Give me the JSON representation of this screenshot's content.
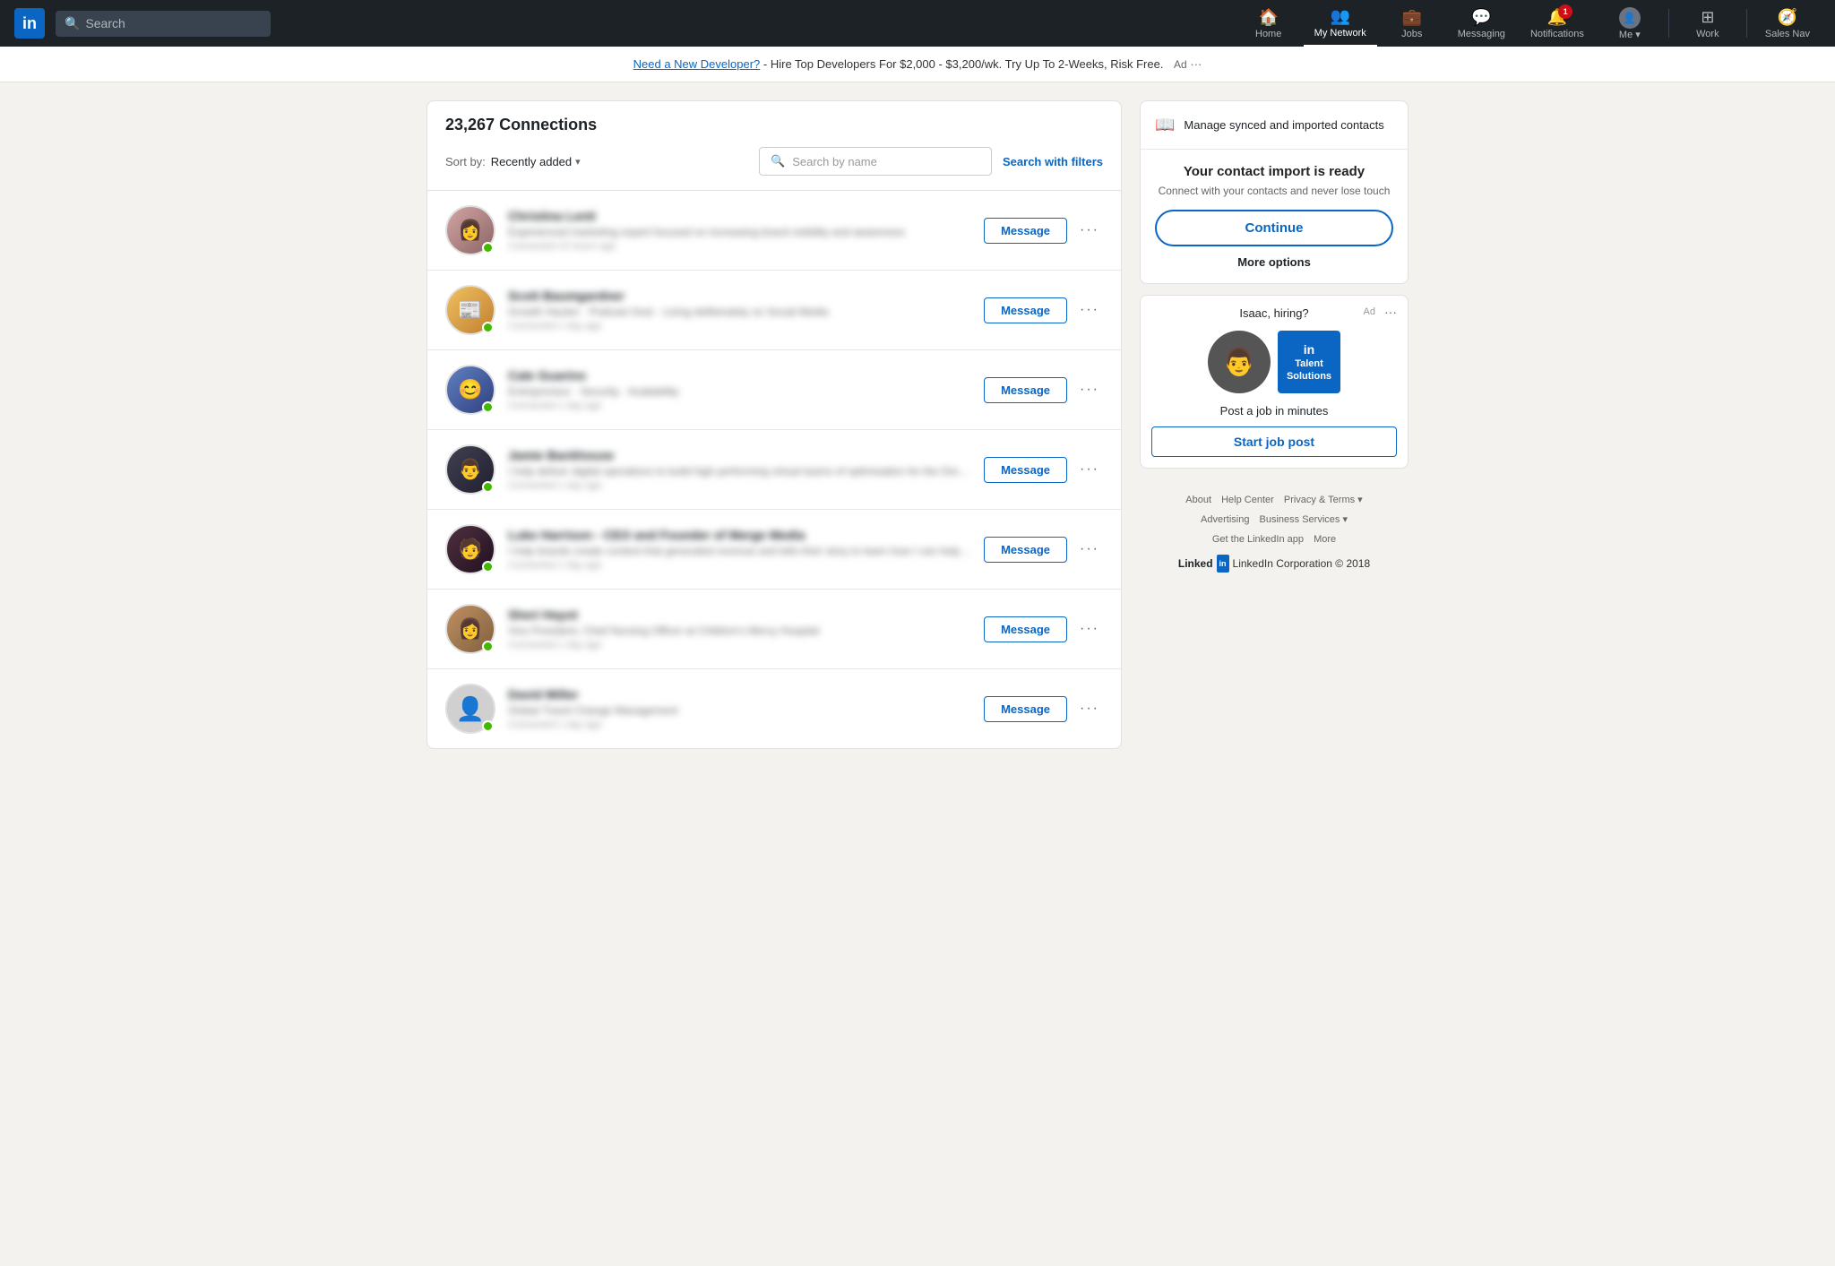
{
  "brand": {
    "logo": "in",
    "name": "LinkedIn"
  },
  "navbar": {
    "search_placeholder": "Search",
    "items": [
      {
        "id": "home",
        "label": "Home",
        "icon": "🏠",
        "badge": null,
        "active": false
      },
      {
        "id": "my-network",
        "label": "My Network",
        "icon": "👥",
        "badge": null,
        "active": true
      },
      {
        "id": "jobs",
        "label": "Jobs",
        "icon": "💼",
        "badge": null,
        "active": false
      },
      {
        "id": "messaging",
        "label": "Messaging",
        "icon": "💬",
        "badge": null,
        "active": false
      },
      {
        "id": "notifications",
        "label": "Notifications",
        "icon": "🔔",
        "badge": "1",
        "active": false
      },
      {
        "id": "me",
        "label": "Me",
        "icon": "👤",
        "badge": null,
        "active": false,
        "has_dropdown": true
      },
      {
        "id": "work",
        "label": "Work",
        "icon": "⊞",
        "badge": null,
        "active": false,
        "has_dropdown": true
      },
      {
        "id": "sales-nav",
        "label": "Sales Nav",
        "icon": "🧭",
        "badge": null,
        "active": false
      }
    ]
  },
  "ad_banner": {
    "link_text": "Need a New Developer?",
    "rest_text": " - Hire Top Developers For $2,000 - $3,200/wk. Try Up To 2-Weeks, Risk Free.",
    "label": "Ad",
    "more": "···"
  },
  "connections": {
    "count": "23,267",
    "title": "Connections",
    "sort_label": "Sort by:",
    "sort_value": "Recently added",
    "search_placeholder": "Search by name",
    "search_with_filters": "Search with filters",
    "items": [
      {
        "id": 1,
        "name": "Christina Lenti",
        "title": "Experienced marketing expert focused on increasing brand visibility and awareness",
        "time": "Connected 10 hours ago",
        "online": true,
        "avatar_class": "av1"
      },
      {
        "id": 2,
        "name": "Scott Baumgardner",
        "title": "Growth Hacker · Podcast Host · Living deliberately on Social Media",
        "time": "Connected 1 day ago",
        "online": true,
        "avatar_class": "av2"
      },
      {
        "id": 3,
        "name": "Cale Guarino",
        "title": "Entrepreneur · Security · Availability",
        "time": "Connected 1 day ago",
        "online": true,
        "avatar_class": "av3"
      },
      {
        "id": 4,
        "name": "Jamie Backhouse",
        "title": "I help deliver digital operations to build high performing virtual teams of optimisation for the Dream Team Interview",
        "time": "Connected 1 day ago",
        "online": true,
        "avatar_class": "av4"
      },
      {
        "id": 5,
        "name": "Luke Harrison - CEO and Founder of Merge Media",
        "title": "I help brands create content that generated revenue and tells their story to learn how I can help your brand",
        "time": "Connected 1 day ago",
        "online": true,
        "avatar_class": "av5"
      },
      {
        "id": 6,
        "name": "Sheri Hayot",
        "title": "Vice President, Chief Nursing Officer at Children's Mercy Hospital",
        "time": "Connected 1 day ago",
        "online": true,
        "avatar_class": "av6"
      },
      {
        "id": 7,
        "name": "David Miller",
        "title": "Global Travel Change Management",
        "time": "Connected 1 day ago",
        "online": true,
        "avatar_class": "av7",
        "placeholder": true
      }
    ],
    "message_button": "Message",
    "more_button": "···"
  },
  "right_panel": {
    "manage_contacts": {
      "icon": "📖",
      "title": "Manage synced and imported contacts"
    },
    "contact_import": {
      "title": "Your contact import is ready",
      "description": "Connect with your contacts and never lose touch",
      "continue_label": "Continue",
      "more_options_label": "More options"
    },
    "ad": {
      "label": "Ad",
      "more": "···",
      "hiring_title": "Isaac, hiring?",
      "logo_line1": "Talent",
      "logo_line2": "Solutions",
      "post_job_title": "Post a job in minutes",
      "start_job_label": "Start job post"
    },
    "footer": {
      "links": [
        {
          "label": "About"
        },
        {
          "label": "Help Center"
        },
        {
          "label": "Privacy & Terms",
          "has_dropdown": true
        },
        {
          "label": "Advertising"
        },
        {
          "label": "Business Services",
          "has_dropdown": true
        },
        {
          "label": "Get the LinkedIn app"
        },
        {
          "label": "More"
        }
      ],
      "copyright": "LinkedIn Corporation © 2018"
    }
  }
}
